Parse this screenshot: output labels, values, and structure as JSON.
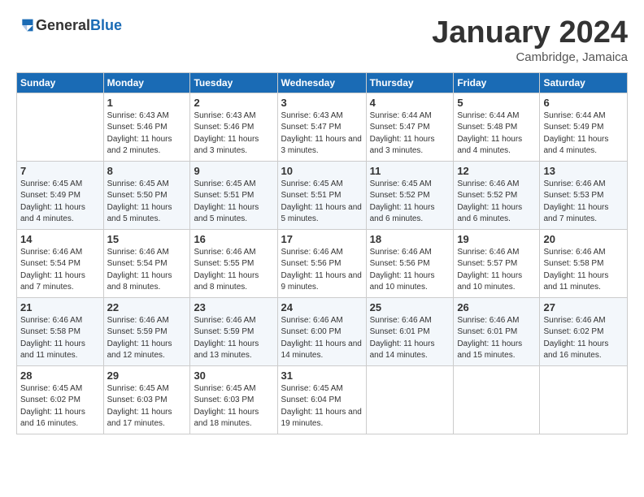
{
  "header": {
    "logo": {
      "general": "General",
      "blue": "Blue"
    },
    "month_title": "January 2024",
    "location": "Cambridge, Jamaica"
  },
  "weekdays": [
    "Sunday",
    "Monday",
    "Tuesday",
    "Wednesday",
    "Thursday",
    "Friday",
    "Saturday"
  ],
  "weeks": [
    [
      {
        "day": "",
        "sunrise": "",
        "sunset": "",
        "daylight": ""
      },
      {
        "day": "1",
        "sunrise": "Sunrise: 6:43 AM",
        "sunset": "Sunset: 5:46 PM",
        "daylight": "Daylight: 11 hours and 2 minutes."
      },
      {
        "day": "2",
        "sunrise": "Sunrise: 6:43 AM",
        "sunset": "Sunset: 5:46 PM",
        "daylight": "Daylight: 11 hours and 3 minutes."
      },
      {
        "day": "3",
        "sunrise": "Sunrise: 6:43 AM",
        "sunset": "Sunset: 5:47 PM",
        "daylight": "Daylight: 11 hours and 3 minutes."
      },
      {
        "day": "4",
        "sunrise": "Sunrise: 6:44 AM",
        "sunset": "Sunset: 5:47 PM",
        "daylight": "Daylight: 11 hours and 3 minutes."
      },
      {
        "day": "5",
        "sunrise": "Sunrise: 6:44 AM",
        "sunset": "Sunset: 5:48 PM",
        "daylight": "Daylight: 11 hours and 4 minutes."
      },
      {
        "day": "6",
        "sunrise": "Sunrise: 6:44 AM",
        "sunset": "Sunset: 5:49 PM",
        "daylight": "Daylight: 11 hours and 4 minutes."
      }
    ],
    [
      {
        "day": "7",
        "sunrise": "Sunrise: 6:45 AM",
        "sunset": "Sunset: 5:49 PM",
        "daylight": "Daylight: 11 hours and 4 minutes."
      },
      {
        "day": "8",
        "sunrise": "Sunrise: 6:45 AM",
        "sunset": "Sunset: 5:50 PM",
        "daylight": "Daylight: 11 hours and 5 minutes."
      },
      {
        "day": "9",
        "sunrise": "Sunrise: 6:45 AM",
        "sunset": "Sunset: 5:51 PM",
        "daylight": "Daylight: 11 hours and 5 minutes."
      },
      {
        "day": "10",
        "sunrise": "Sunrise: 6:45 AM",
        "sunset": "Sunset: 5:51 PM",
        "daylight": "Daylight: 11 hours and 5 minutes."
      },
      {
        "day": "11",
        "sunrise": "Sunrise: 6:45 AM",
        "sunset": "Sunset: 5:52 PM",
        "daylight": "Daylight: 11 hours and 6 minutes."
      },
      {
        "day": "12",
        "sunrise": "Sunrise: 6:46 AM",
        "sunset": "Sunset: 5:52 PM",
        "daylight": "Daylight: 11 hours and 6 minutes."
      },
      {
        "day": "13",
        "sunrise": "Sunrise: 6:46 AM",
        "sunset": "Sunset: 5:53 PM",
        "daylight": "Daylight: 11 hours and 7 minutes."
      }
    ],
    [
      {
        "day": "14",
        "sunrise": "Sunrise: 6:46 AM",
        "sunset": "Sunset: 5:54 PM",
        "daylight": "Daylight: 11 hours and 7 minutes."
      },
      {
        "day": "15",
        "sunrise": "Sunrise: 6:46 AM",
        "sunset": "Sunset: 5:54 PM",
        "daylight": "Daylight: 11 hours and 8 minutes."
      },
      {
        "day": "16",
        "sunrise": "Sunrise: 6:46 AM",
        "sunset": "Sunset: 5:55 PM",
        "daylight": "Daylight: 11 hours and 8 minutes."
      },
      {
        "day": "17",
        "sunrise": "Sunrise: 6:46 AM",
        "sunset": "Sunset: 5:56 PM",
        "daylight": "Daylight: 11 hours and 9 minutes."
      },
      {
        "day": "18",
        "sunrise": "Sunrise: 6:46 AM",
        "sunset": "Sunset: 5:56 PM",
        "daylight": "Daylight: 11 hours and 10 minutes."
      },
      {
        "day": "19",
        "sunrise": "Sunrise: 6:46 AM",
        "sunset": "Sunset: 5:57 PM",
        "daylight": "Daylight: 11 hours and 10 minutes."
      },
      {
        "day": "20",
        "sunrise": "Sunrise: 6:46 AM",
        "sunset": "Sunset: 5:58 PM",
        "daylight": "Daylight: 11 hours and 11 minutes."
      }
    ],
    [
      {
        "day": "21",
        "sunrise": "Sunrise: 6:46 AM",
        "sunset": "Sunset: 5:58 PM",
        "daylight": "Daylight: 11 hours and 11 minutes."
      },
      {
        "day": "22",
        "sunrise": "Sunrise: 6:46 AM",
        "sunset": "Sunset: 5:59 PM",
        "daylight": "Daylight: 11 hours and 12 minutes."
      },
      {
        "day": "23",
        "sunrise": "Sunrise: 6:46 AM",
        "sunset": "Sunset: 5:59 PM",
        "daylight": "Daylight: 11 hours and 13 minutes."
      },
      {
        "day": "24",
        "sunrise": "Sunrise: 6:46 AM",
        "sunset": "Sunset: 6:00 PM",
        "daylight": "Daylight: 11 hours and 14 minutes."
      },
      {
        "day": "25",
        "sunrise": "Sunrise: 6:46 AM",
        "sunset": "Sunset: 6:01 PM",
        "daylight": "Daylight: 11 hours and 14 minutes."
      },
      {
        "day": "26",
        "sunrise": "Sunrise: 6:46 AM",
        "sunset": "Sunset: 6:01 PM",
        "daylight": "Daylight: 11 hours and 15 minutes."
      },
      {
        "day": "27",
        "sunrise": "Sunrise: 6:46 AM",
        "sunset": "Sunset: 6:02 PM",
        "daylight": "Daylight: 11 hours and 16 minutes."
      }
    ],
    [
      {
        "day": "28",
        "sunrise": "Sunrise: 6:45 AM",
        "sunset": "Sunset: 6:02 PM",
        "daylight": "Daylight: 11 hours and 16 minutes."
      },
      {
        "day": "29",
        "sunrise": "Sunrise: 6:45 AM",
        "sunset": "Sunset: 6:03 PM",
        "daylight": "Daylight: 11 hours and 17 minutes."
      },
      {
        "day": "30",
        "sunrise": "Sunrise: 6:45 AM",
        "sunset": "Sunset: 6:03 PM",
        "daylight": "Daylight: 11 hours and 18 minutes."
      },
      {
        "day": "31",
        "sunrise": "Sunrise: 6:45 AM",
        "sunset": "Sunset: 6:04 PM",
        "daylight": "Daylight: 11 hours and 19 minutes."
      },
      {
        "day": "",
        "sunrise": "",
        "sunset": "",
        "daylight": ""
      },
      {
        "day": "",
        "sunrise": "",
        "sunset": "",
        "daylight": ""
      },
      {
        "day": "",
        "sunrise": "",
        "sunset": "",
        "daylight": ""
      }
    ]
  ]
}
